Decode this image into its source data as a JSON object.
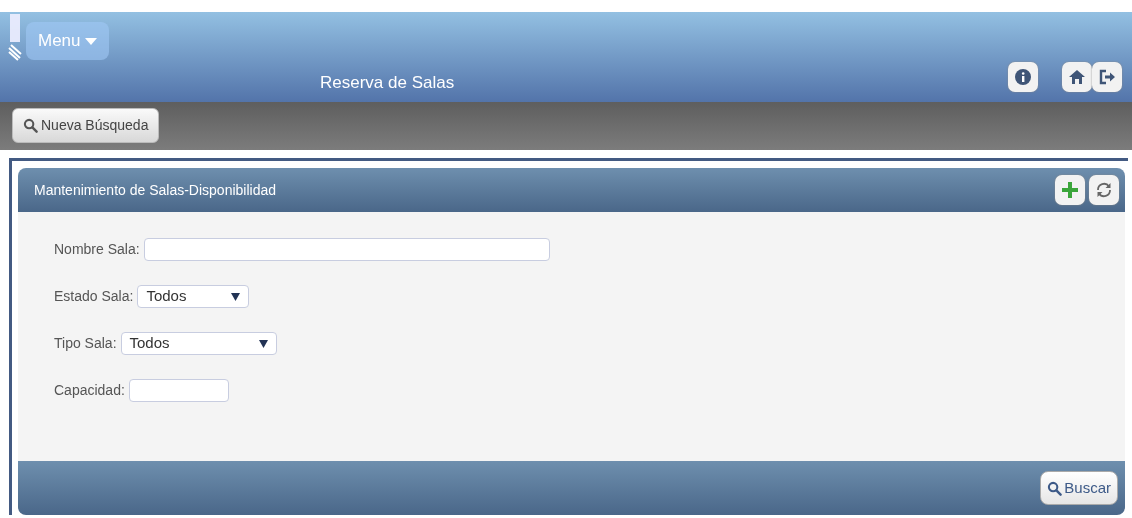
{
  "header": {
    "menu_label": "Menu",
    "title": "Reserva de Salas"
  },
  "toolbar": {
    "new_search_label": "Nueva Búsqueda"
  },
  "panel": {
    "title": "Mantenimiento de Salas-Disponibilidad",
    "fields": [
      {
        "kind": "text",
        "label": "Nombre Sala:"
      },
      {
        "kind": "select",
        "label": "Estado Sala:",
        "value": "Todos"
      },
      {
        "kind": "select",
        "label": "Tipo Sala:",
        "value": "Todos"
      },
      {
        "kind": "text",
        "label": "Capacidad:"
      }
    ],
    "search_label": "Buscar"
  }
}
